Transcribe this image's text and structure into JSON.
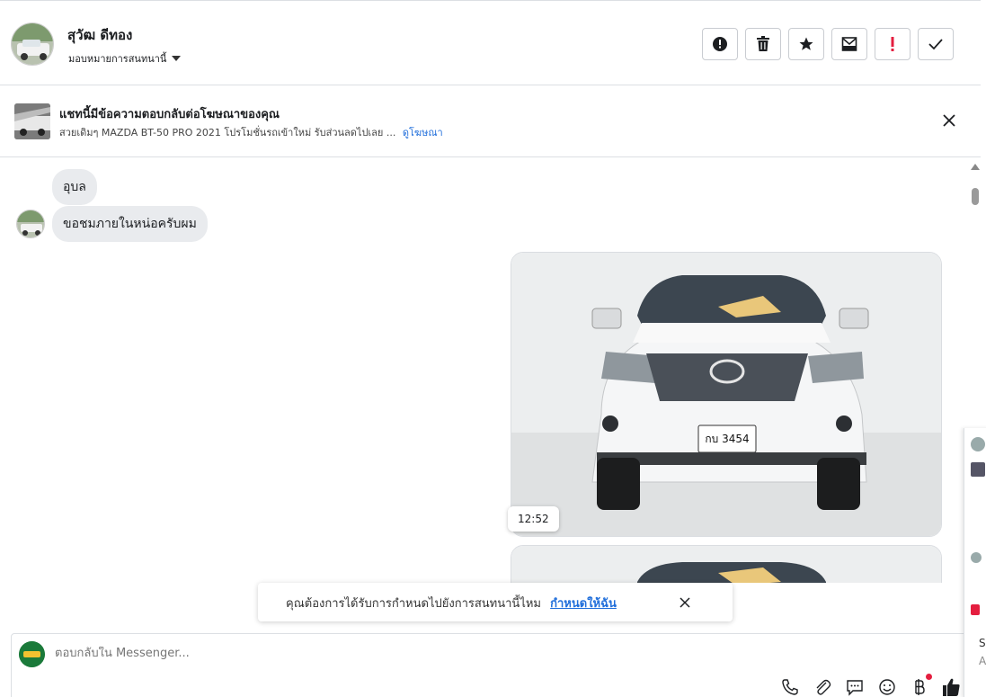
{
  "header": {
    "contact_name": "สุวัฒ ดีทอง",
    "assign_label": "มอบหมายการสนทนานี้",
    "actions": [
      {
        "name": "report-button",
        "icon": "alert-circle-icon"
      },
      {
        "name": "delete-button",
        "icon": "trash-icon"
      },
      {
        "name": "star-button",
        "icon": "star-icon"
      },
      {
        "name": "archive-button",
        "icon": "archive-envelope-icon"
      },
      {
        "name": "mark-important-button",
        "icon": "exclamation-icon"
      },
      {
        "name": "mark-done-button",
        "icon": "check-icon"
      }
    ]
  },
  "ad_banner": {
    "title": "แชทนี้มีข้อความตอบกลับต่อโฆษณาของคุณ",
    "description": "สวยเดิมๆ MAZDA BT-50 PRO 2021 โปรโมชั่นรถเข้าใหม่ รับส่วนลดไปเลย ...",
    "link_label": "ดูโฆษณา"
  },
  "messages": {
    "incoming_1": "อุบล",
    "incoming_2": "ขอชมภายในหน่อครับผม",
    "photo_time": "12:52",
    "plate_text": "กบ 3454"
  },
  "reminder": {
    "text": "คุณต้องการได้รับการกำหนดไปยังการสนทนานี้ไหม",
    "link_label": "กำหนดให้ฉัน"
  },
  "composer": {
    "placeholder": "ตอบกลับใน Messenger...",
    "tools": [
      "phone-icon",
      "paperclip-icon",
      "chat-bubble-icon",
      "emoji-icon",
      "baht-icon",
      "thumbs-up-icon"
    ]
  },
  "side_panel": {
    "text_1": "S",
    "text_2": "A"
  },
  "colors": {
    "link_blue": "#216fdb",
    "bubble_gray": "#e9ebee",
    "alert_red": "#e41e3f",
    "border": "#dcdfe3"
  }
}
